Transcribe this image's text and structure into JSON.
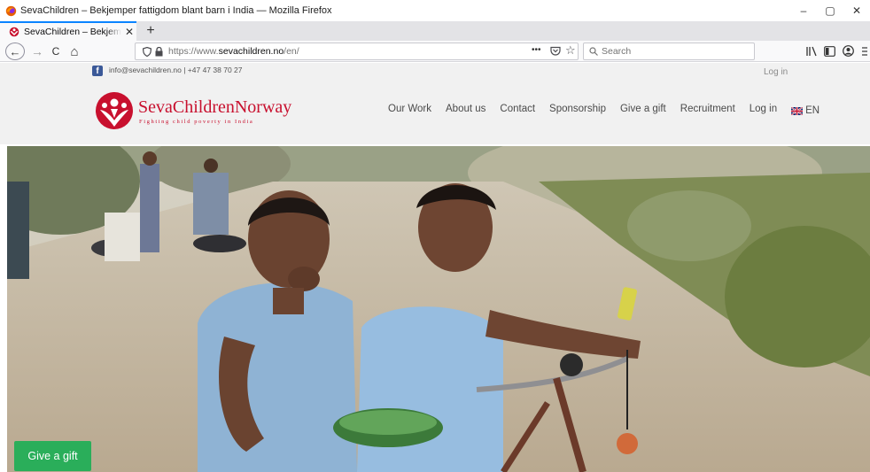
{
  "window": {
    "title": "SevaChildren – Bekjemper fattigdom blant barn i India — Mozilla Firefox",
    "controls": {
      "minimize": "–",
      "maximize": "▢",
      "close": "✕"
    }
  },
  "tabs": [
    {
      "label": "SevaChildren – Bekjemper fattigdom blant barn i India",
      "close": "✕",
      "active": true
    }
  ],
  "new_tab_label": "+",
  "nav": {
    "back": "←",
    "forward": "→",
    "reload": "C",
    "home": "⌂",
    "url_prefix": "https://www.",
    "url_domain": "sevachildren.no",
    "url_path": "/en/",
    "page_actions": "•••",
    "search_placeholder": "Search"
  },
  "page": {
    "topbar": {
      "contact": "info@sevachildren.no | +47 47 38 70 27",
      "login": "Log in"
    },
    "logo": {
      "name": "SevaChildrenNorway",
      "tagline": "Fighting child poverty in India"
    },
    "menu": [
      {
        "label": "Our Work"
      },
      {
        "label": "About us"
      },
      {
        "label": "Contact"
      },
      {
        "label": "Sponsorship"
      },
      {
        "label": "Give a gift"
      },
      {
        "label": "Recruitment"
      },
      {
        "label": "Log in"
      }
    ],
    "language": "EN",
    "hero": {
      "button": "Give a gift"
    }
  },
  "colors": {
    "brand_red": "#c8102e",
    "button_green": "#2aae5a",
    "tab_accent": "#0a84ff",
    "facebook_blue": "#3b5998"
  },
  "icons": [
    "firefox-icon",
    "shield-icon",
    "lock-icon",
    "pocket-icon",
    "star-icon",
    "search-icon",
    "library-icon",
    "sidebar-icon",
    "account-icon",
    "menu-icon",
    "facebook-icon",
    "uk-flag-icon"
  ]
}
